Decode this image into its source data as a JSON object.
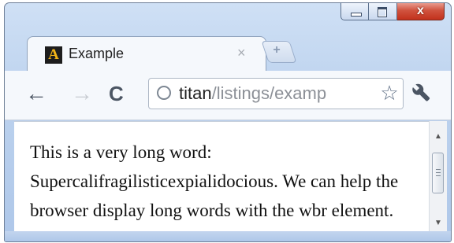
{
  "window": {
    "controls": {
      "minimize": "minimize-icon",
      "maximize": "maximize-icon",
      "close": "close-icon"
    },
    "close_glyph": "x"
  },
  "tab": {
    "title": "Example",
    "close_glyph": "×",
    "favicon_letter": "A"
  },
  "newtab": {
    "glyph": "+"
  },
  "toolbar": {
    "back_glyph": "←",
    "forward_glyph": "→",
    "reload_glyph": "C",
    "address": {
      "host": "titan",
      "path": "/listings/examp"
    },
    "star_glyph": "☆",
    "wrench_glyph": "🔧"
  },
  "content": {
    "text": "This is a very long word: Supercalifragilisticexpialidocious. We can help the browser display long words with the wbr element."
  },
  "colors": {
    "frame": "#bcd2ee",
    "close_button": "#c2311c",
    "favicon_bg": "#1d1d1d",
    "favicon_fg": "#f2b418"
  }
}
